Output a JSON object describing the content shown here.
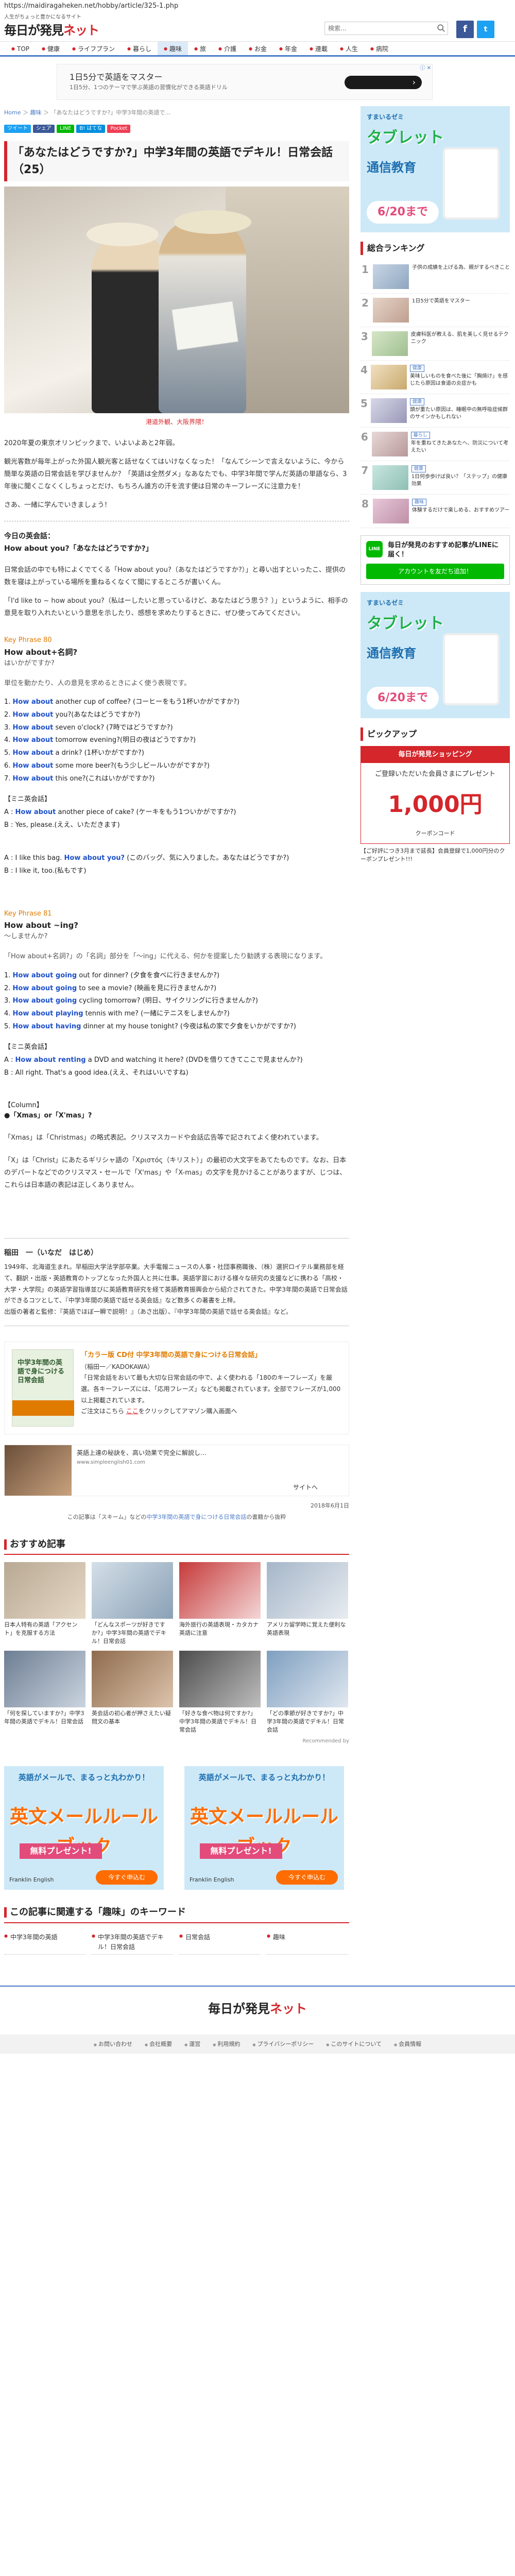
{
  "browser": {
    "url": "https://maidiragaheken.net/hobby/article/325-1.php"
  },
  "header": {
    "tagline": "人生がちょっと豊かになるサイト",
    "logo_main": "毎日が発見",
    "logo_accent": "ネット",
    "search_placeholder": "検索...",
    "fb_label": "f",
    "tw_label": "t"
  },
  "nav": [
    "TOP",
    "健康",
    "ライフプラン",
    "暮らし",
    "趣味",
    "旅",
    "介護",
    "お金",
    "年金",
    "連載",
    "人生",
    "病院",
    "健康"
  ],
  "ad_banner": {
    "title": "1日5分で英語をマスター",
    "sub": "1日5分、1つのテーマで学ぶ英語の習慣化ができる英語ドリル",
    "x": "ⓘ ✕"
  },
  "breadcrumb": {
    "home": "Home",
    "sep1": " ＞ ",
    "cat": "趣味",
    "sep2": " ＞ ",
    "current": "「あなたはどうですか?」中学3年間の英語で…"
  },
  "share": [
    "ツイート",
    "シェア",
    "LINE",
    "B! はてな",
    "Pocket"
  ],
  "article": {
    "title": "「あなたはどうですか?」中学3年間の英語でデキル！日常会話（25）",
    "hero_caption": "港道外観、大阪界隈！",
    "intro1": "2020年夏の東京オリンピックまで、いよいよあと2年弱。",
    "intro2": "観光客数が毎年上がった外国人観光客と話せなくてはいけなくなった！「なんてシーンで言えないように、今から簡単な英語の日常会話を学びませんか？「英語は全然ダメ」なあなたでも、中学3年間で学んだ英語の単語なら、3年後に聞くこなくくしちょっとだけ、もちろん誰方の汗を流す便は日常のキーフレーズに注意力を！",
    "intro3": "さあ、一緒に学んでいきましょう！",
    "today_head": "今日の英会話：",
    "today_phrase": "How about you?「あなたはどうですか?」",
    "p1": "日常会話の中でも特によくでてくる「How about you?（あなたはどうですか?）」と尋い出すといったこ、提供の数を寝は上がっている場所を重ねるくなくて聞にするところが書いくん。",
    "p2": "「I'd like to ~ how about you?（私はーしたいと思っているけど、あなたはどう思う？）」というように、相手の意見を取り入れたいという意思を示したり、感想を求めたりするときに、ぜひ使ってみてください。",
    "kp80": "Key Phrase 80",
    "kp80_title": "How about+名詞?",
    "kp80_sub": "はいかがですか?",
    "kp80_desc": "単位を動かたり、人の意見を求めるときによく使う表現です。",
    "kp80_list": [
      {
        "num": "1.",
        "en": "How about",
        "rest": " another cup of coffee? (コーヒーをもう1杯いかがですか?)"
      },
      {
        "num": "2.",
        "en": "How about",
        "rest": " you?(あなたはどうですか?)"
      },
      {
        "num": "3.",
        "en": "How about",
        "rest": " seven o'clock? (7時ではどうですか?)"
      },
      {
        "num": "4.",
        "en": "How about",
        "rest": " tomorrow evening?(明日の夜はどうですか?)"
      },
      {
        "num": "5.",
        "en": "How about",
        "rest": " a drink? (1杯いかがですか?)"
      },
      {
        "num": "6.",
        "en": "How about",
        "rest": " some more beer?(もう少しビールいかがですか?)"
      },
      {
        "num": "7.",
        "en": "How about",
        "rest": " this one?(これはいかがですか?)"
      }
    ],
    "kp80_convo_head": "【ミニ英会話】",
    "kp80_convo": [
      {
        "speaker": "A : ",
        "en": "How about",
        "rest": " another piece of cake? (ケーキをもう1ついかがですか?)"
      },
      {
        "speaker": "B : ",
        "en": "",
        "rest": "Yes, please.(ええ、いただきます)"
      }
    ],
    "kp80_convo2": [
      {
        "speaker": "A : ",
        "en": "",
        "pre": "I like this bag. ",
        "mid": "How about you?",
        "rest": " (このバッグ、気に入りました。あなたはどうですか?)"
      },
      {
        "speaker": "B : ",
        "en": "",
        "pre": "",
        "mid": "",
        "rest": "I like it, too.(私もです)"
      }
    ],
    "kp81": "Key Phrase 81",
    "kp81_title": "How about ~ing?",
    "kp81_sub": "～しませんか?",
    "kp81_desc": "「How about+名詞?」の「名詞」部分を「～ing」に代える、何かを提案したり勧誘する表現になります。",
    "kp81_list": [
      {
        "num": "1.",
        "en": "How about going",
        "rest": " out for dinner? (夕食を食べに行きませんか?)"
      },
      {
        "num": "2.",
        "en": "How about going",
        "rest": " to see a movie? (映画を見に行きませんか?)"
      },
      {
        "num": "3.",
        "en": "How about going",
        "rest": " cycling tomorrow? (明日、サイクリングに行きませんか?)"
      },
      {
        "num": "4.",
        "en": "How about playing",
        "rest": " tennis with me? (一緒にテニスをしませんか?)"
      },
      {
        "num": "5.",
        "en": "How about having",
        "rest": " dinner at my house tonight? (今夜は私の家で夕食をいかがですか?)"
      }
    ],
    "kp81_convo_head": "【ミニ英会話】",
    "kp81_convo": [
      {
        "speaker": "A : ",
        "en": "How about renting",
        "rest": " a DVD and watching it here? (DVDを借りてきてここで見ませんか?)"
      },
      {
        "speaker": "B : ",
        "en": "",
        "rest": "All right. That's a good idea.(ええ、それはいいですね)"
      }
    ],
    "column_head": "【Column】",
    "column_title": "●「Xmas」or「X'mas」?",
    "column_p1": "「Xmas」は「Christmas」の略式表記。クリスマスカードや会話広告等で記されてよく使われています。",
    "column_p2": "「X」は「Christ」にあたるギリシャ語の「Χριστός（キリスト）」の最初の大文字をあてたものです。なお、日本のデパートなどでのクリスマス・セールで「X'mas」や「X-mas」の文字を見かけることがありますが、じつは、これらは日本語の表記は正しくありません。"
  },
  "profile": {
    "name": "稲田　一（いなだ　はじめ）",
    "text": "1949年、北海道生まれ。早稲田大学法学部卒業。大手電報ニュースの人事・社団事務職後、（株）選択ロイテル業務部を経て、翻訳・出版・英語教育のトップとなった外国人と共に仕事。英語学習における様々な研究の支援などに携わる「高校・大学・大学院」の英語学習指導並びに英語教育研究を経て英語教育振興会から紹介されてきた。中学3年間の英語で日常会話ができるコツとして、『中学3年間の英語で話せる英会話』など数多くの著書を上梓。",
    "text2": "出版の著者と監修：『英語でほぼ一瞬で説明！』（あさ出版）、『中学3年間の英語で話せる英会話』など。"
  },
  "book": {
    "title": "「カラー版 CD付 中学3年間の英語で身につける日常会話」",
    "publisher": "（稲田一／KADOKAWA）",
    "desc": "「日常会話をおいて最も大切な日常会話の中で、よく使われる「180のキーフレーズ」を厳選。各キーフレーズには、「応用フレーズ」なども掲載されています。全部でフレーズが1,000以上掲載されています。",
    "link_pre": "ご注文はこちら ",
    "link": "ここ",
    "link_post": "をクリックしてアマゾン購入画面へ"
  },
  "cover": {
    "title": "中学3年間の英語で身につける日常会話"
  },
  "ext_ad": {
    "title": "英語上達の秘訣を、高い効果で完全に解説し…",
    "url": "www.simpleenglish01.com",
    "site": "サイトへ"
  },
  "meta": {
    "date": "2018年6月1日",
    "related_pre": "この記事は「スキーム」などの",
    "related_link": "中学3年間の英語で身につける日常会話",
    "related_post": "の書籍から抜粋"
  },
  "reco_head": "おすすめ記事",
  "reco": [
    "日本人特有の英語「アクセント」を克服する方法",
    "「どんなスポーツが好きですか?」中学3年間の英語でデキル！日常会話",
    "海外旅行の英語表現・カタカナ英語に注意",
    "アメリカ留学時に覚えた便利な英語表現",
    "「何を探していますか?」中学3年間の英語でデキル！日常会話",
    "英会話の初心者が押さえたい疑問文の基本",
    "「好きな食べ物は何ですか?」中学3年間の英語でデキル！日常会話",
    "「どの季節が好きですか?」中学3年間の英語でデキル！日常会話"
  ],
  "reco_more": "Recommended by",
  "promos": [
    {
      "top": "英語がメールで、まるっと丸わかり！",
      "big": "英文メールルールブック",
      "band": "無料プレゼント!",
      "btn": "今すぐ申込む",
      "logo": "Franklin English"
    },
    {
      "top": "英語がメールで、まるっと丸わかり！",
      "big": "英文メールルールブック",
      "band": "無料プレゼント!",
      "btn": "今すぐ申込む",
      "logo": "Franklin English"
    }
  ],
  "kw_head": "この記事に関連する「趣味」のキーワード",
  "keywords": [
    "中学3年間の英語",
    "中学3年間の英語でデキル！日常会話",
    "日常会話",
    "趣味"
  ],
  "sidebar": {
    "ad": {
      "top": "すまいるゼミ",
      "big": "タブレット",
      "mid": "通信教育",
      "date": "6/20まで"
    },
    "ranking_head": "総合ランキング",
    "ranking": [
      {
        "num": "1",
        "tag": "",
        "text": "子供の成績を上げる為、親がするべきこと"
      },
      {
        "num": "2",
        "tag": "",
        "text": "1日5分で英語をマスター"
      },
      {
        "num": "3",
        "tag": "",
        "text": "皮膚科医が教える、肌を美しく見せるテクニック"
      },
      {
        "num": "4",
        "tag": "健康",
        "text": "美味しいものを食べた後に「胸焼け」を感じたら原因は食道の炎症かも"
      },
      {
        "num": "5",
        "tag": "健康",
        "text": "頭が重たい原因は、睡眠中の無呼吸症候群のサインかもしれない"
      },
      {
        "num": "6",
        "tag": "暮らし",
        "text": "年を重ねてきたあなたへ、防災について考えたい"
      },
      {
        "num": "7",
        "tag": "健康",
        "text": "1日何歩歩けば良い？「ステップ」の健康効果"
      },
      {
        "num": "8",
        "tag": "趣味",
        "text": "体験するだけで楽しめる、おすすめツアー"
      }
    ],
    "line": {
      "icon": "LINE",
      "title": "毎日が発見のおすすめ記事がLINEに届く！",
      "btn": "アカウントを友だち追加！"
    },
    "pickup_head": "ピックアップ",
    "pickup": {
      "top": "毎日が発見ショッピング",
      "mid": "ご登録いただいた会員さまにプレゼント",
      "big": "1,000円",
      "foot": "クーポンコード",
      "caption": "【ご好評につき3月まで延長】会員登録で1,000円分のクーポンプレゼント!!!"
    }
  },
  "footer": {
    "logo_main": "毎日が発見",
    "logo_accent": "ネット",
    "links": [
      "お問い合わせ",
      "会社概要",
      "運営",
      "利用規約",
      "プライバシーポリシー",
      "このサイトについて",
      "会員情報"
    ]
  }
}
